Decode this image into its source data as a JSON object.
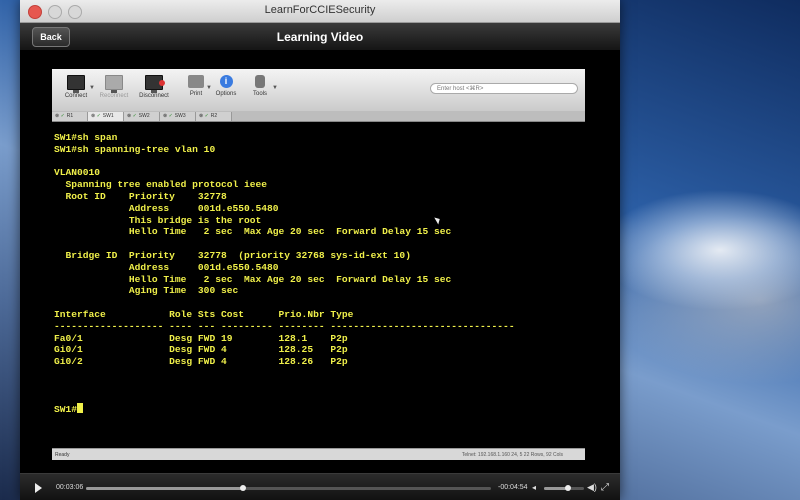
{
  "window": {
    "title": "LearnForCCIESecurity"
  },
  "navbar": {
    "back_label": "Back",
    "title": "Learning Video"
  },
  "app_toolbar": {
    "items": [
      {
        "label": "Connect",
        "icon": "monitor-icon",
        "enabled": true
      },
      {
        "label": "Reconnect",
        "icon": "reconnect-icon",
        "enabled": false
      },
      {
        "label": "Disconnect",
        "icon": "disconnect-icon",
        "enabled": true
      },
      {
        "label": "Print",
        "icon": "printer-icon",
        "enabled": true
      },
      {
        "label": "Options",
        "icon": "info-icon",
        "enabled": true
      },
      {
        "label": "Tools",
        "icon": "tools-icon",
        "enabled": true
      }
    ],
    "search_placeholder": "Enter host <⌘R>"
  },
  "session_tabs": [
    {
      "label": "R1",
      "active": false
    },
    {
      "label": "SW1",
      "active": true
    },
    {
      "label": "SW2",
      "active": false
    },
    {
      "label": "SW3",
      "active": false
    },
    {
      "label": "R2",
      "active": false
    }
  ],
  "terminal": {
    "lines": [
      "SW1#sh span",
      "SW1#sh spanning-tree vlan 10",
      "",
      "VLAN0010",
      "  Spanning tree enabled protocol ieee",
      "  Root ID    Priority    32778",
      "             Address     001d.e550.5480",
      "             This bridge is the root",
      "             Hello Time   2 sec  Max Age 20 sec  Forward Delay 15 sec",
      "",
      "  Bridge ID  Priority    32778  (priority 32768 sys-id-ext 10)",
      "             Address     001d.e550.5480",
      "             Hello Time   2 sec  Max Age 20 sec  Forward Delay 15 sec",
      "             Aging Time  300 sec",
      "",
      "Interface           Role Sts Cost      Prio.Nbr Type",
      "------------------- ---- --- --------- -------- --------------------------------",
      "Fa0/1               Desg FWD 19        128.1    P2p",
      "Gi0/1               Desg FWD 4         128.25   P2p",
      "Gi0/2               Desg FWD 4         128.26   P2p",
      "",
      "",
      ""
    ],
    "prompt": "SW1#"
  },
  "app_status": {
    "left": "Ready",
    "right": "Telnet: 192.168.1.160   24, 5   22 Rows, 92 Cols"
  },
  "player": {
    "current_time": "00:03:06",
    "remaining_time": "-00:04:54",
    "progress_fraction": 0.388,
    "volume_fraction": 0.6
  }
}
